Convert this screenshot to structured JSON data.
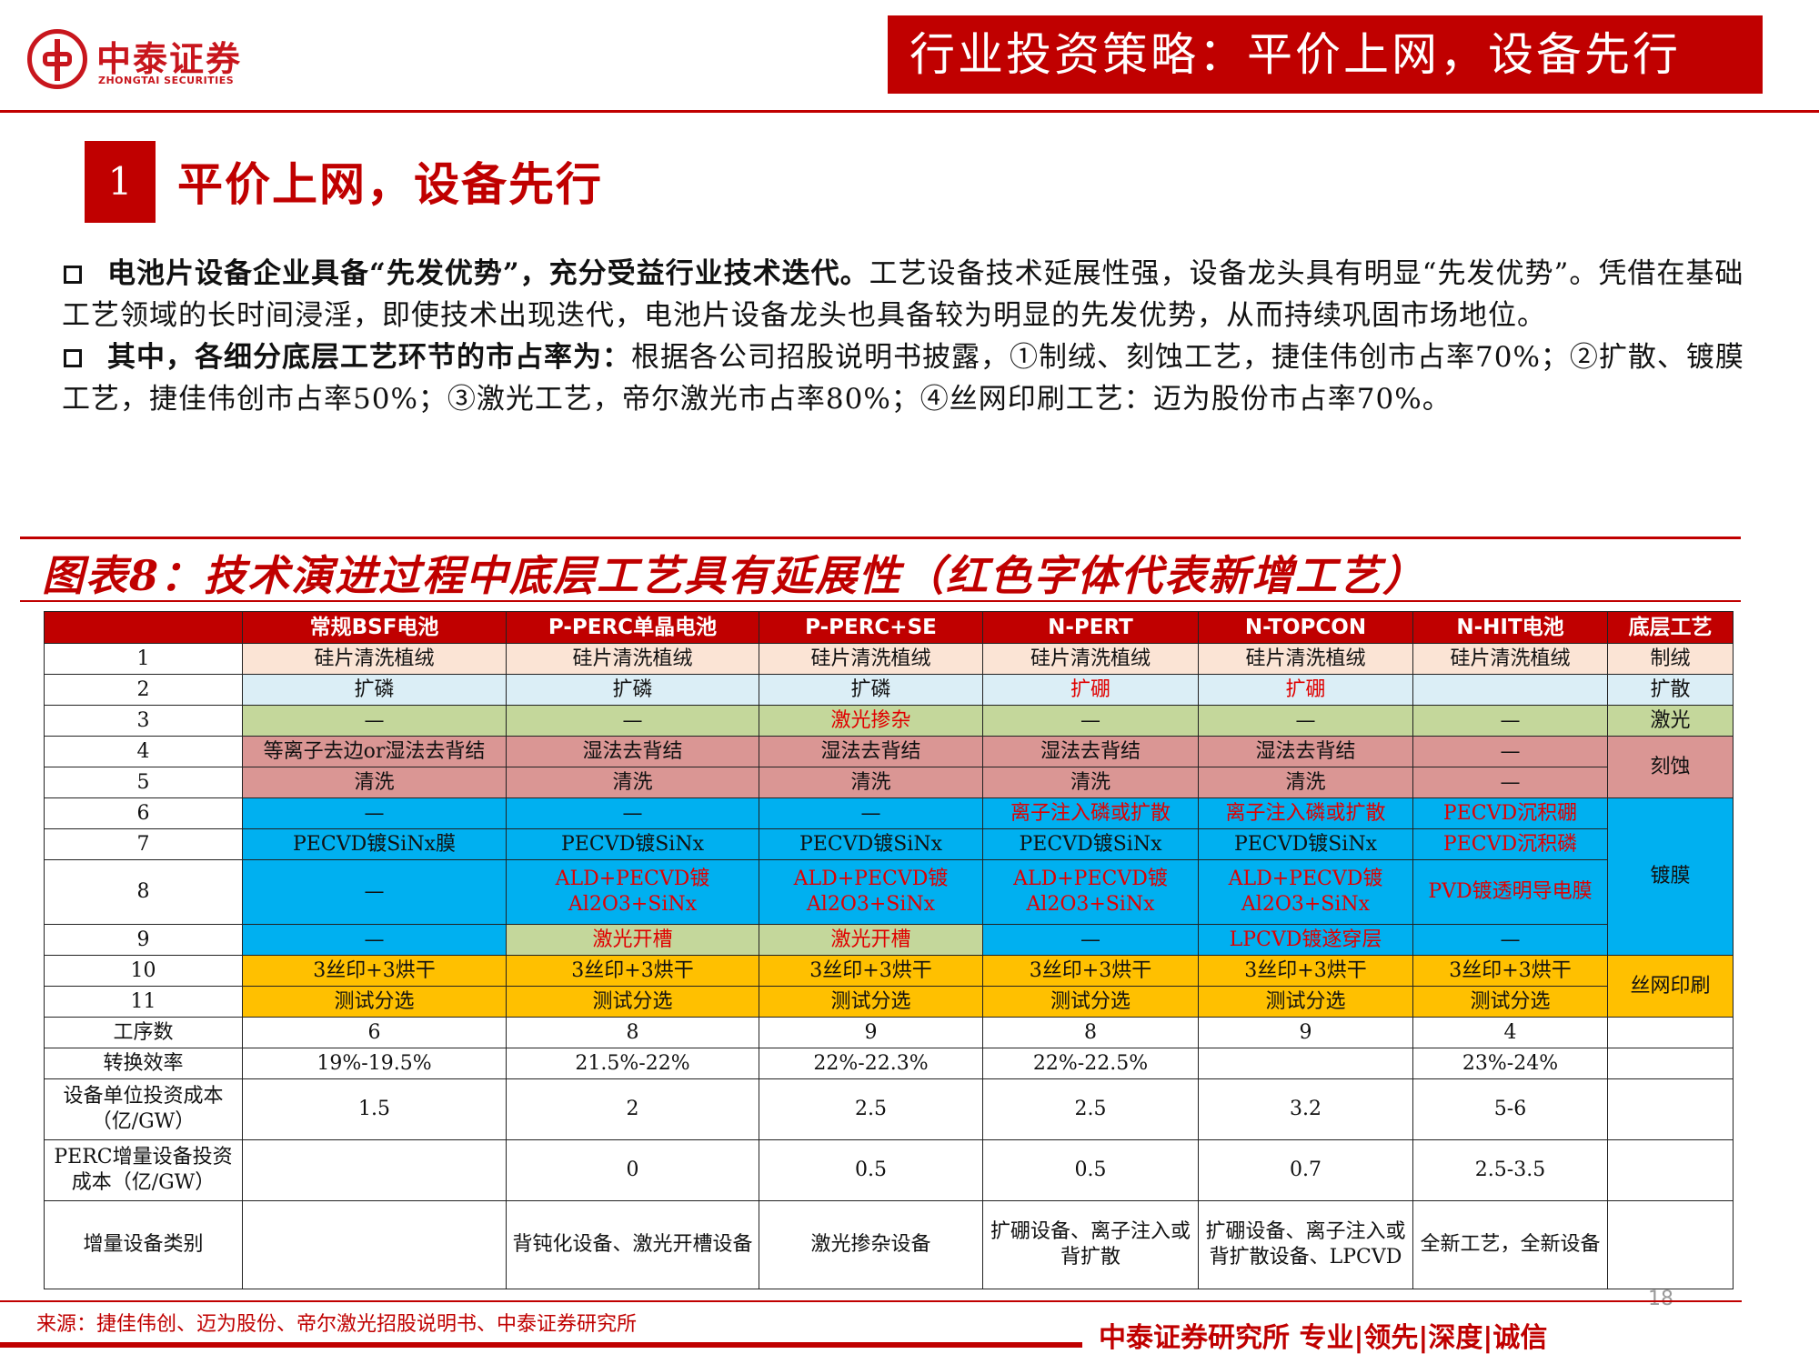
{
  "header": {
    "logo_cn": "中泰证券",
    "logo_en": "ZHONGTAI SECURITIES",
    "banner": "行业投资策略：平价上网，设备先行"
  },
  "section": {
    "number": "1",
    "title": "平价上网，设备先行"
  },
  "bullets": [
    {
      "bold": "电池片设备企业具备“先发优势”，充分受益行业技术迭代。",
      "text": "工艺设备技术延展性强，设备龙头具有明显“先发优势”。凭借在基础工艺领域的长时间浸淫，即使技术出现迭代，电池片设备龙头也具备较为明显的先发优势，从而持续巩固市场地位。"
    },
    {
      "bold": "其中，各细分底层工艺环节的市占率为：",
      "text": "根据各公司招股说明书披露，①制绒、刻蚀工艺，捷佳伟创市占率70%；②扩散、镀膜工艺，捷佳伟创市占率50%；③激光工艺，帝尔激光市占率80%；④丝网印刷工艺：迈为股份市占率70%。"
    }
  ],
  "figure_title": "图表8：技术演进过程中底层工艺具有延展性（红色字体代表新增工艺）",
  "table": {
    "headers": [
      "",
      "常规BSF电池",
      "P-PERC单晶电池",
      "P-PERC+SE",
      "N-PERT",
      "N-TOPCON",
      "N-HIT电池",
      "底层工艺"
    ],
    "rows": {
      "r1": [
        "1",
        "硅片清洗植绒",
        "硅片清洗植绒",
        "硅片清洗植绒",
        "硅片清洗植绒",
        "硅片清洗植绒",
        "硅片清洗植绒",
        "制绒"
      ],
      "r2": [
        "2",
        "扩磷",
        "扩磷",
        "扩磷",
        "扩硼",
        "扩硼",
        "",
        "扩散"
      ],
      "r3": [
        "3",
        "—",
        "—",
        "激光掺杂",
        "—",
        "—",
        "—",
        "激光"
      ],
      "r4": [
        "4",
        "等离子去边or湿法去背结",
        "湿法去背结",
        "湿法去背结",
        "湿法去背结",
        "湿法去背结",
        "—",
        "刻蚀"
      ],
      "r5": [
        "5",
        "清洗",
        "清洗",
        "清洗",
        "清洗",
        "清洗",
        "—"
      ],
      "r6": [
        "6",
        "—",
        "—",
        "—",
        "离子注入磷或扩散",
        "离子注入磷或扩散",
        "PECVD沉积硼",
        "镀膜"
      ],
      "r7": [
        "7",
        "PECVD镀SiNx膜",
        "PECVD镀SiNx",
        "PECVD镀SiNx",
        "PECVD镀SiNx",
        "PECVD镀SiNx",
        "PECVD沉积磷"
      ],
      "r8": [
        "8",
        "—",
        "ALD+PECVD镀Al2O3+SiNx",
        "ALD+PECVD镀Al2O3+SiNx",
        "ALD+PECVD镀Al2O3+SiNx",
        "ALD+PECVD镀Al2O3+SiNx",
        "PVD镀透明导电膜"
      ],
      "r9": [
        "9",
        "—",
        "激光开槽",
        "激光开槽",
        "—",
        "LPCVD镀遂穿层",
        "—"
      ],
      "r10": [
        "10",
        "3丝印+3烘干",
        "3丝印+3烘干",
        "3丝印+3烘干",
        "3丝印+3烘干",
        "3丝印+3烘干",
        "3丝印+3烘干",
        "丝网印刷"
      ],
      "r11": [
        "11",
        "测试分选",
        "测试分选",
        "测试分选",
        "测试分选",
        "测试分选",
        "测试分选"
      ],
      "steps": [
        "工序数",
        "6",
        "8",
        "9",
        "8",
        "9",
        "4",
        ""
      ],
      "eff": [
        "转换效率",
        "19%-19.5%",
        "21.5%-22%",
        "22%-22.3%",
        "22%-22.5%",
        "",
        "23%-24%",
        ""
      ],
      "cost": [
        "设备单位投资成本（亿/GW）",
        "1.5",
        "2",
        "2.5",
        "2.5",
        "3.2",
        "5-6",
        ""
      ],
      "inc": [
        "PERC增量设备投资成本（亿/GW）",
        "",
        "0",
        "0.5",
        "0.5",
        "0.7",
        "2.5-3.5",
        ""
      ],
      "cat": [
        "增量设备类别",
        "",
        "背钝化设备、激光开槽设备",
        "激光掺杂设备",
        "扩硼设备、离子注入或背扩散",
        "扩硼设备、离子注入或背扩散设备、LPCVD",
        "全新工艺，全新设备",
        ""
      ]
    }
  },
  "source": "来源：捷佳伟创、迈为股份、帝尔激光招股说明书、中泰证券研究所",
  "page_number": "18",
  "footer": "中泰证券研究所 专业|领先|深度|诚信",
  "colors": {
    "brand_red": "#c00000",
    "pink": "#fbe4d5",
    "light_blue": "#dbeef6",
    "green": "#c4d79b",
    "rose": "#da9694",
    "blue": "#00b0f0",
    "yellow": "#ffc000",
    "new_process_red": "#e00000"
  }
}
